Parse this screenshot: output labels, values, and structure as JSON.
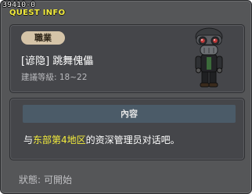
{
  "quest": {
    "id": "39410-0",
    "header": "QUEST INFO"
  },
  "job": {
    "badge": "職業",
    "name": "[谚隐] 跳舞傀儡",
    "level_req": "建議等級: 18~22"
  },
  "content": {
    "header": "內容",
    "text_prefix": "与",
    "text_highlight": "东部第4地区",
    "text_suffix": "的资深管理员对话吧。"
  },
  "status": {
    "label": "狀態:",
    "value": "可開始"
  },
  "colors": {
    "highlight": "#f3ec3c",
    "title": "#f3ec3c"
  }
}
